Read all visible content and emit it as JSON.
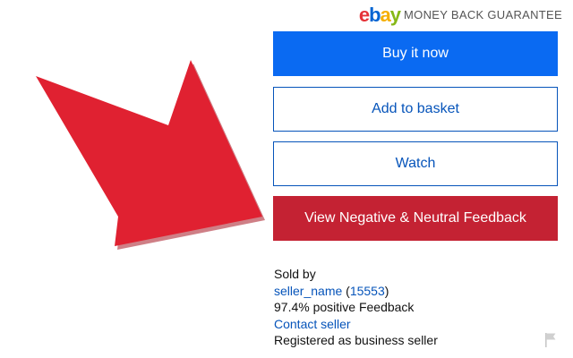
{
  "header": {
    "logo_letters": [
      "e",
      "b",
      "a",
      "y"
    ],
    "logo_colors": [
      "#e53238",
      "#0064d2",
      "#f5af02",
      "#86b817"
    ],
    "guarantee_text": "MONEY BACK GUARANTEE"
  },
  "arrow": {
    "icon": "arrow-icon",
    "color": "#e02131"
  },
  "buttons": {
    "buy_now": "Buy it now",
    "add_to_basket": "Add to basket",
    "watch": "Watch",
    "view_feedback": "View Negative & Neutral Feedback"
  },
  "colors": {
    "primary": "#0a6af2",
    "link": "#0654ba",
    "feedback": "#c42233"
  },
  "seller": {
    "sold_by_label": "Sold by",
    "name": "seller_name",
    "open_paren": " (",
    "feedback_count": "15553",
    "close_paren": ")",
    "positive_feedback": "97.4% positive Feedback",
    "contact_label": "Contact seller",
    "registration": "Registered as business seller"
  },
  "report": {
    "icon": "flag-icon"
  }
}
